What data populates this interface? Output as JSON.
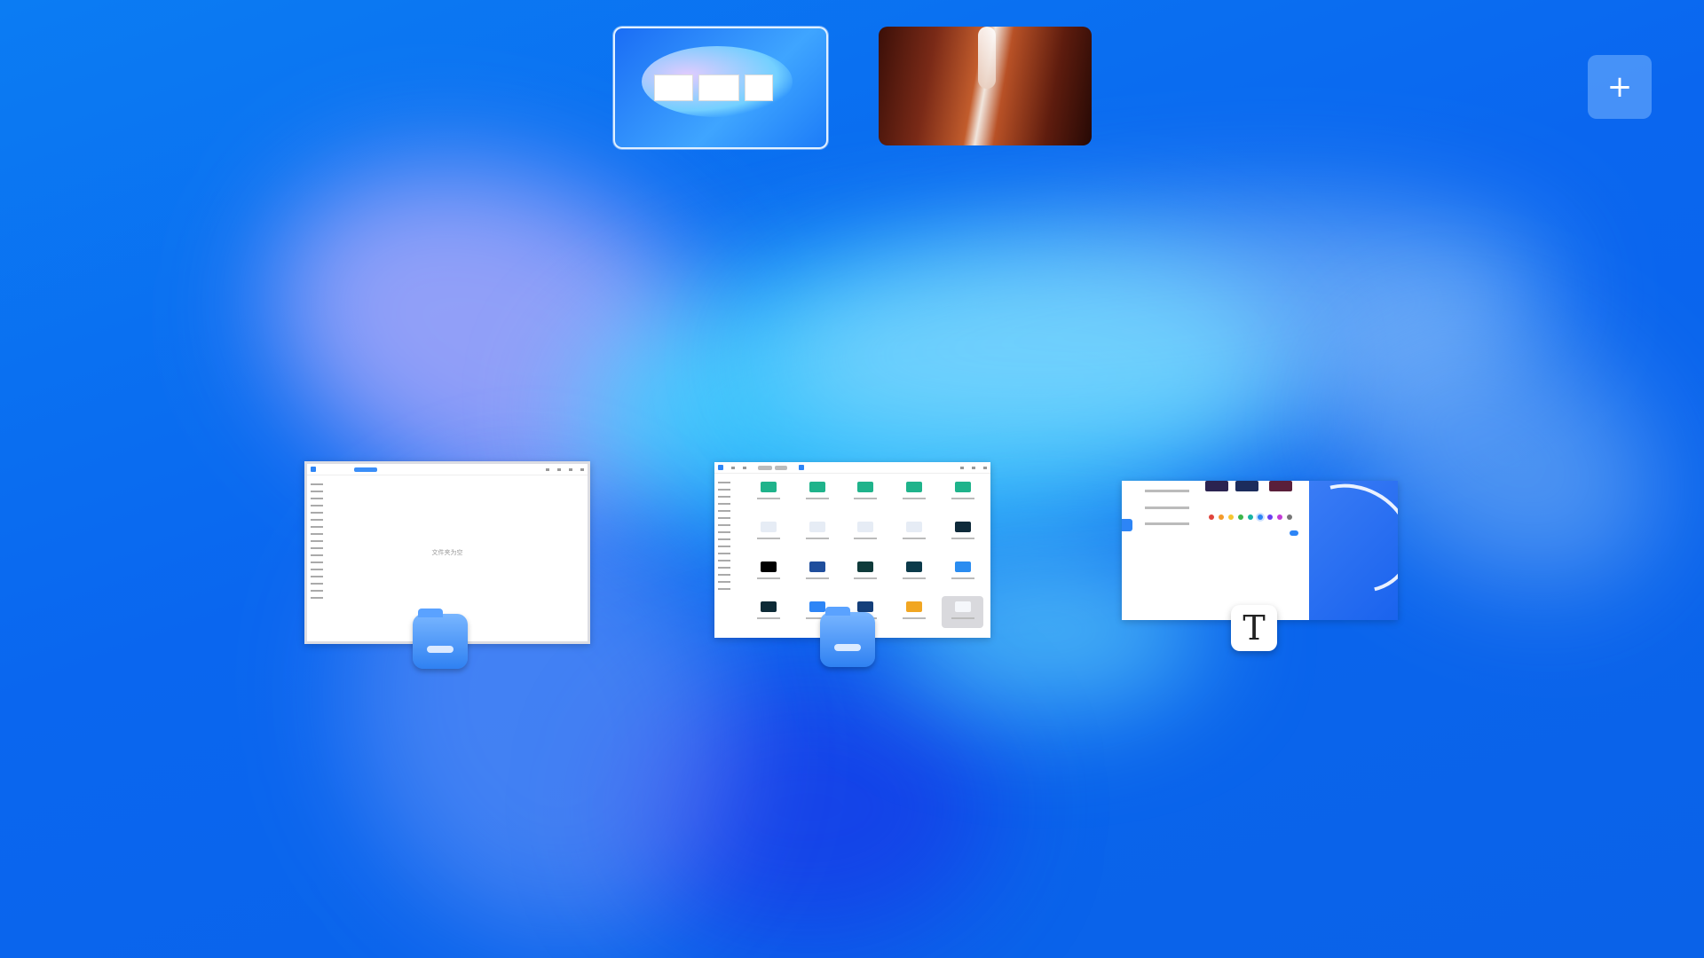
{
  "desktop": {
    "workspaces": [
      {
        "label": "",
        "active": true
      },
      {
        "label": "",
        "active": false
      }
    ],
    "add_workspace_icon": "plus-icon",
    "add_workspace_symbol": "+",
    "colors": {
      "accent": "#2d85f6",
      "background": "#0a72f0"
    }
  },
  "windows": [
    {
      "app_icon": "folder-icon",
      "empty_text": "文件夹为空"
    },
    {
      "app_icon": "folder-icon"
    },
    {
      "app_icon": "text-editor-icon",
      "icon_glyph": "T"
    }
  ]
}
